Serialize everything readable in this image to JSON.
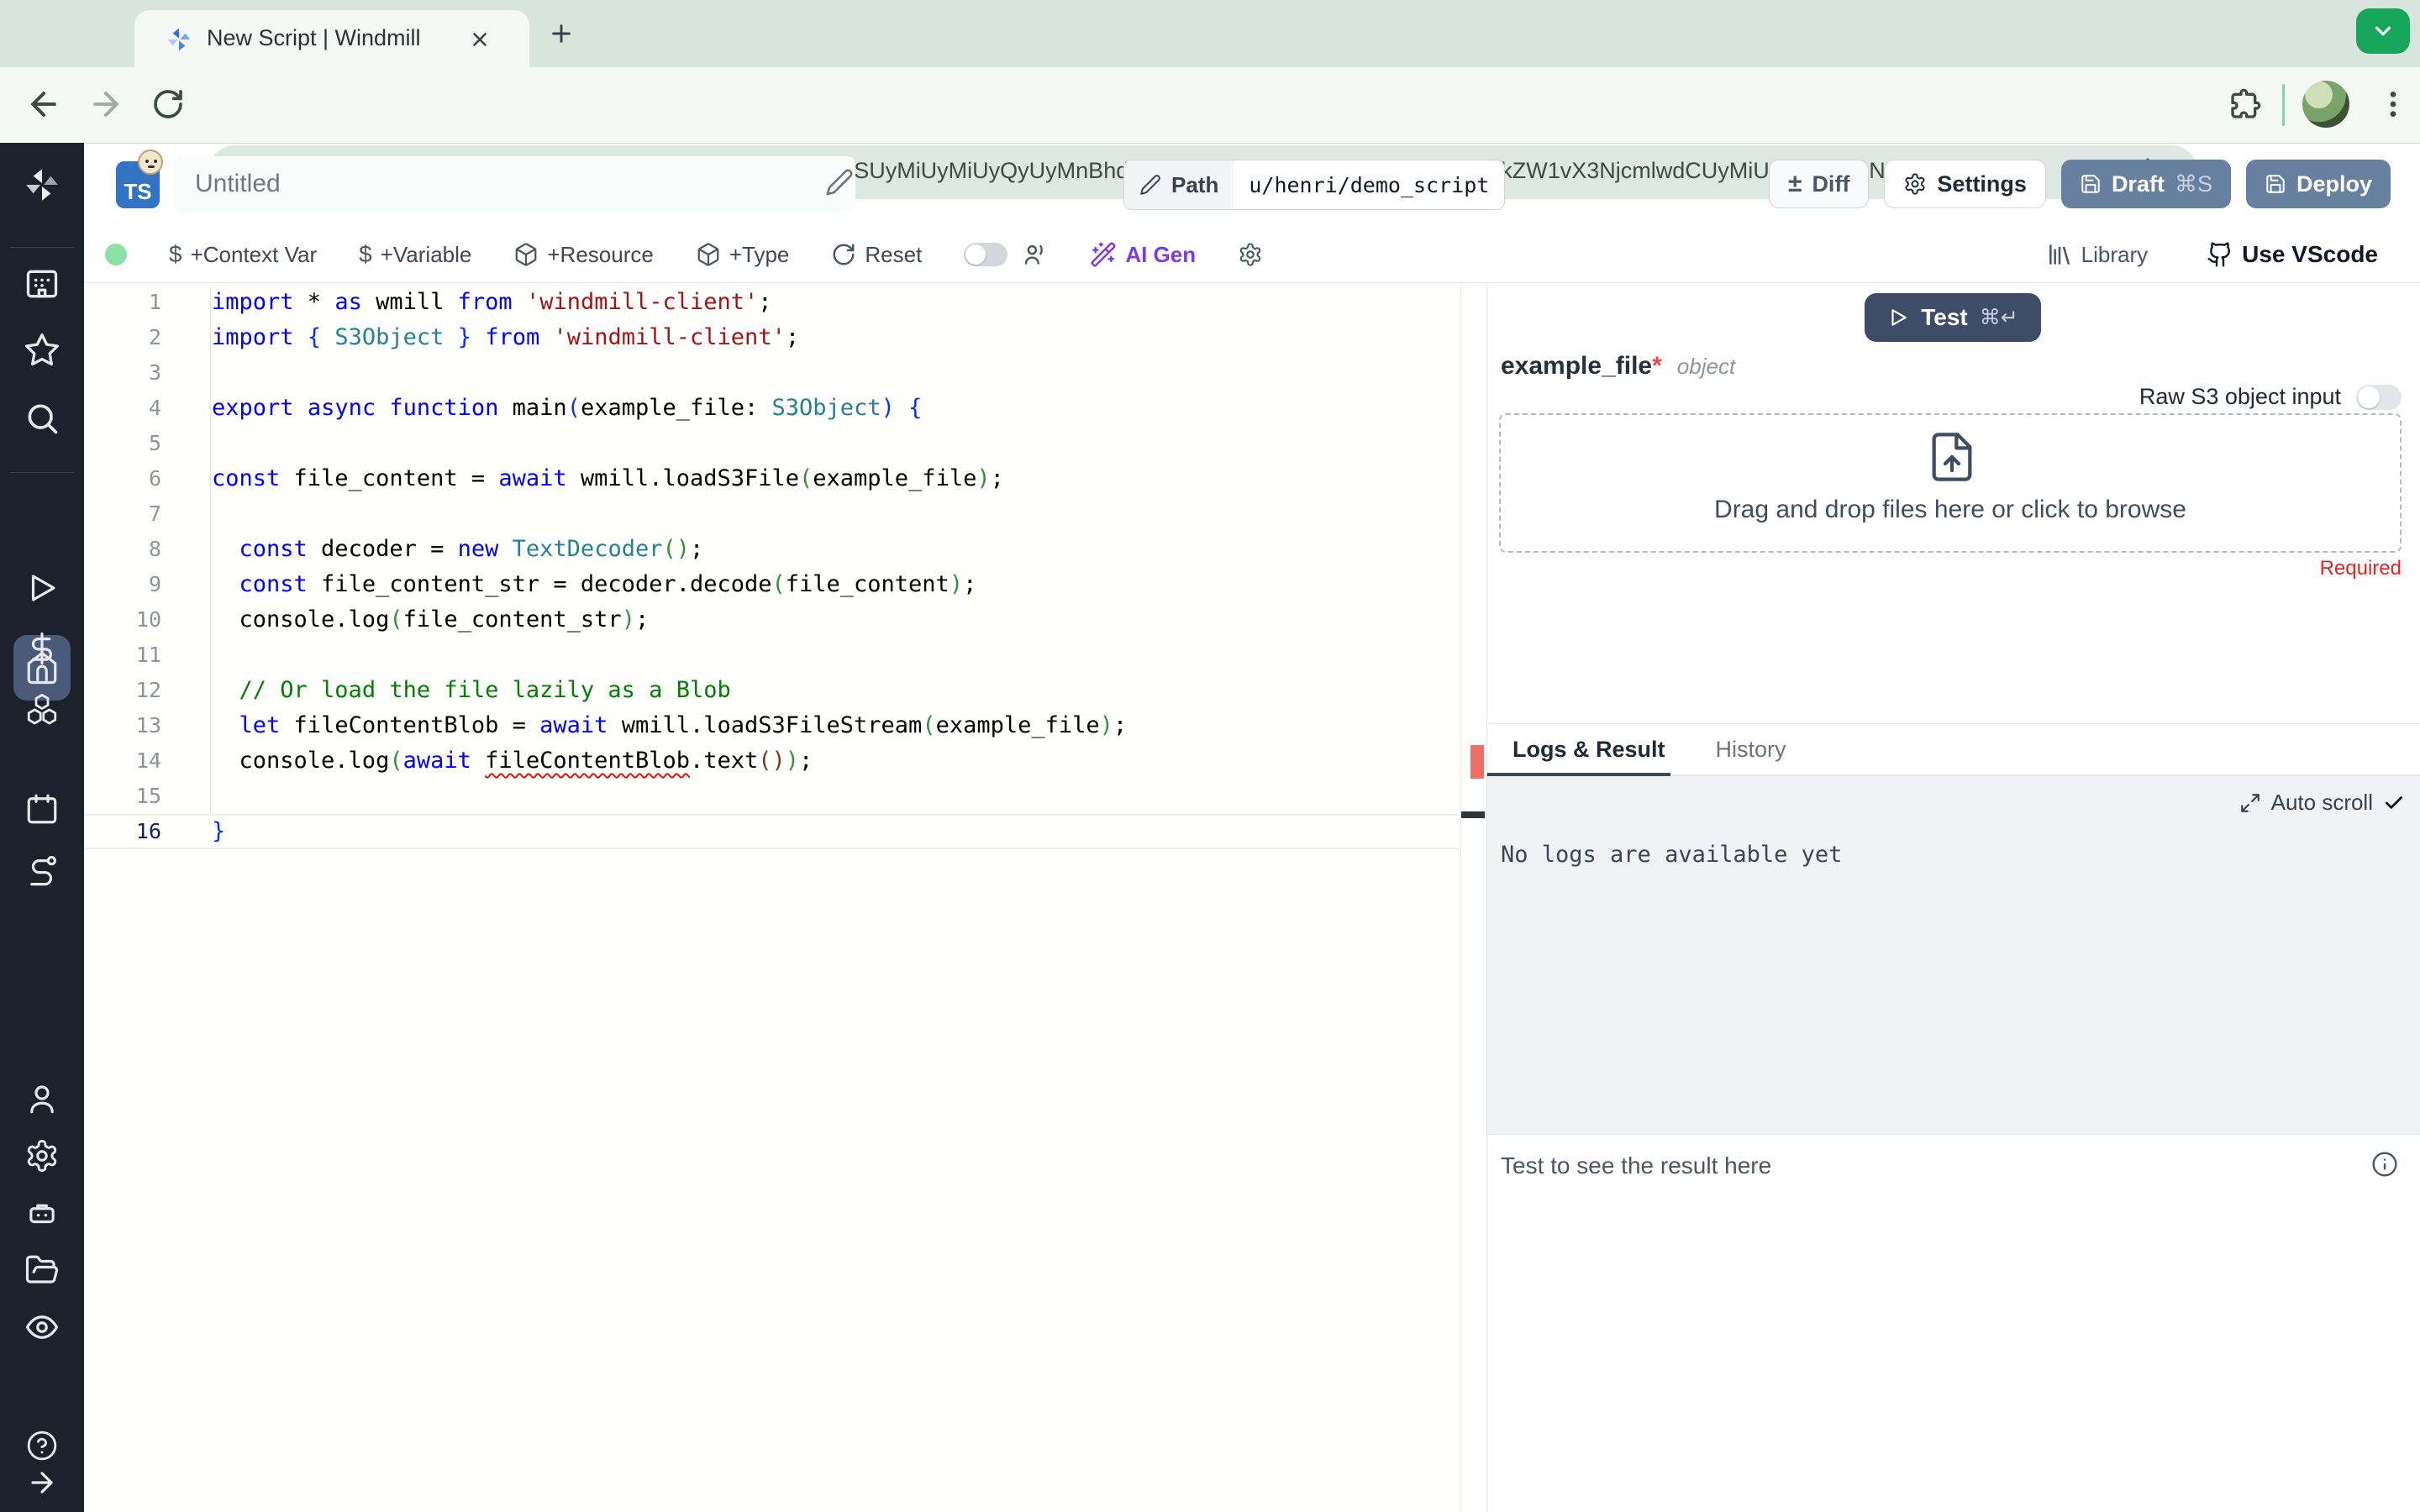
{
  "browser": {
    "tab_title": "New Script | Windmill",
    "url": "app.windmill.dev/scripts/add#JTdCJTIyaGFzaCUyMiUzQSUyMiUyMiUyQyUyMnBhdGglMjIlM0ElMjJ1JTJGaGVucmklMkZkZW1vX3NjcmlwdCUyMiUyQyUyMnN1bW1hc…",
    "green_button_color": "#18a65d"
  },
  "header": {
    "language_badge": "TS",
    "script_name": "Untitled",
    "path_label": "Path",
    "path_value": "u/henri/demo_script",
    "diff_label": "Diff",
    "settings_label": "Settings",
    "draft_label": "Draft",
    "draft_shortcut": "⌘S",
    "deploy_label": "Deploy",
    "primary_button_color": "#68809f"
  },
  "toolbar": {
    "context_var": "+Context Var",
    "variable": "+Variable",
    "resource": "+Resource",
    "type": "+Type",
    "reset": "Reset",
    "ai_gen": "AI Gen",
    "ai_gen_color": "#7c3aed",
    "library": "Library",
    "use_vscode": "Use VScode"
  },
  "sidebar": {
    "top_icons": [
      "windmill-logo",
      "apps",
      "favorites",
      "search"
    ],
    "main_icons": [
      "home",
      "runs",
      "variables",
      "resources",
      "schedules",
      "flows"
    ],
    "bottom_icons": [
      "account",
      "settings",
      "workers",
      "folders",
      "audit-logs",
      "help",
      "expand"
    ],
    "active_item": "home",
    "active_color": "#4a5a7a",
    "background": "#1d212b"
  },
  "editor": {
    "line_count": 16,
    "active_line": 16,
    "error_marker_color": "#ef6f66",
    "token_colors": {
      "keyword": "#0000ff",
      "type": "#267f99",
      "string": "#a31515",
      "comment": "#008000",
      "plain": "#000000",
      "bracket1": "#0431fa",
      "bracket2": "#319331",
      "bracket3": "#7b3814"
    },
    "lines": [
      [
        [
          "kw",
          "import"
        ],
        [
          "pl",
          " * "
        ],
        [
          "kw",
          "as"
        ],
        [
          "pl",
          " wmill "
        ],
        [
          "kw",
          "from"
        ],
        [
          "pl",
          " "
        ],
        [
          "str",
          "'windmill-client'"
        ],
        [
          "pl",
          ";"
        ]
      ],
      [
        [
          "kw",
          "import"
        ],
        [
          "pl",
          " "
        ],
        [
          "b1",
          "{"
        ],
        [
          "pl",
          " "
        ],
        [
          "type",
          "S3Object"
        ],
        [
          "pl",
          " "
        ],
        [
          "b1",
          "}"
        ],
        [
          "pl",
          " "
        ],
        [
          "kw",
          "from"
        ],
        [
          "pl",
          " "
        ],
        [
          "str",
          "'windmill-client'"
        ],
        [
          "pl",
          ";"
        ]
      ],
      [],
      [
        [
          "kw",
          "export"
        ],
        [
          "pl",
          " "
        ],
        [
          "kw",
          "async"
        ],
        [
          "pl",
          " "
        ],
        [
          "kw",
          "function"
        ],
        [
          "pl",
          " main"
        ],
        [
          "b1",
          "("
        ],
        [
          "pl",
          "example_file: "
        ],
        [
          "type",
          "S3Object"
        ],
        [
          "b1",
          ")"
        ],
        [
          "pl",
          " "
        ],
        [
          "b1",
          "{"
        ]
      ],
      [],
      [
        [
          "kw",
          "const"
        ],
        [
          "pl",
          " file_content = "
        ],
        [
          "kw",
          "await"
        ],
        [
          "pl",
          " wmill.loadS3File"
        ],
        [
          "b2",
          "("
        ],
        [
          "pl",
          "example_file"
        ],
        [
          "b2",
          ")"
        ],
        [
          "pl",
          ";"
        ]
      ],
      [],
      [
        [
          "pl",
          "  "
        ],
        [
          "kw",
          "const"
        ],
        [
          "pl",
          " decoder = "
        ],
        [
          "kw",
          "new"
        ],
        [
          "pl",
          " "
        ],
        [
          "type",
          "TextDecoder"
        ],
        [
          "b2",
          "()"
        ],
        [
          "pl",
          ";"
        ]
      ],
      [
        [
          "pl",
          "  "
        ],
        [
          "kw",
          "const"
        ],
        [
          "pl",
          " file_content_str = decoder.decode"
        ],
        [
          "b2",
          "("
        ],
        [
          "pl",
          "file_content"
        ],
        [
          "b2",
          ")"
        ],
        [
          "pl",
          ";"
        ]
      ],
      [
        [
          "pl",
          "  console.log"
        ],
        [
          "b2",
          "("
        ],
        [
          "pl",
          "file_content_str"
        ],
        [
          "b2",
          ")"
        ],
        [
          "pl",
          ";"
        ]
      ],
      [],
      [
        [
          "pl",
          "  "
        ],
        [
          "com",
          "// Or load the file lazily as a Blob"
        ]
      ],
      [
        [
          "pl",
          "  "
        ],
        [
          "kw",
          "let"
        ],
        [
          "pl",
          " fileContentBlob = "
        ],
        [
          "kw",
          "await"
        ],
        [
          "pl",
          " wmill.loadS3FileStream"
        ],
        [
          "b2",
          "("
        ],
        [
          "pl",
          "example_file"
        ],
        [
          "b2",
          ")"
        ],
        [
          "pl",
          ";"
        ]
      ],
      [
        [
          "pl",
          "  console.log"
        ],
        [
          "b2",
          "("
        ],
        [
          "kw",
          "await"
        ],
        [
          "pl",
          " "
        ],
        [
          "err",
          "fileContentBlob"
        ],
        [
          "pl",
          ".text"
        ],
        [
          "b3",
          "()"
        ],
        [
          "b2",
          ")"
        ],
        [
          "pl",
          ";"
        ]
      ],
      [],
      [
        [
          "b1",
          "}"
        ]
      ]
    ]
  },
  "preview": {
    "test_label": "Test",
    "test_shortcut": "⌘↵",
    "test_button_color": "#3d4d68",
    "arg_name": "example_file",
    "arg_required_mark": "*",
    "arg_type": "object",
    "raw_s3_label": "Raw S3 object input",
    "dropzone_text": "Drag and drop files here or click to browse",
    "required_label": "Required",
    "tabs": [
      "Logs & Result",
      "History"
    ],
    "auto_scroll_label": "Auto scroll",
    "no_logs_text": "No logs are available yet",
    "result_placeholder": "Test to see the result here"
  }
}
